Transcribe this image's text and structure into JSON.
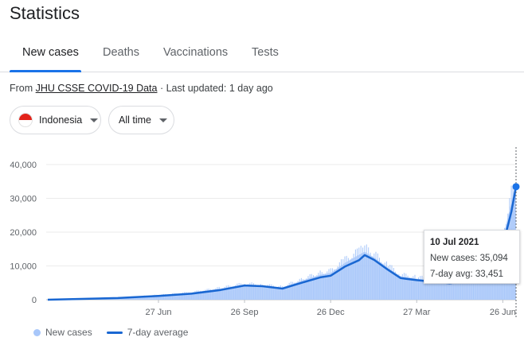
{
  "page": {
    "title": "Statistics"
  },
  "tabs": [
    {
      "label": "New cases"
    },
    {
      "label": "Deaths"
    },
    {
      "label": "Vaccinations"
    },
    {
      "label": "Tests"
    }
  ],
  "source": {
    "prefix": "From",
    "link": "JHU CSSE COVID-19 Data",
    "suffix": "· Last updated: 1 day ago"
  },
  "filters": {
    "region": "Indonesia",
    "period": "All time"
  },
  "colors": {
    "accent": "#1a73e8",
    "bars": "#a8c7fa",
    "avg_line": "#1967d2",
    "flag_red": "#e2231a"
  },
  "tooltip": {
    "date": "10 Jul 2021",
    "new_cases": "New cases: 35,094",
    "avg": "7-day avg: 33,451"
  },
  "legend": {
    "bars": "New cases",
    "line": "7-day average"
  },
  "chart_data": {
    "type": "area",
    "x_ticks": [
      "27 Jun",
      "26 Sep",
      "26 Dec",
      "27 Mar",
      "26 Jun"
    ],
    "y_ticks": [
      "0",
      "10,000",
      "20,000",
      "30,000",
      "40,000"
    ],
    "ylim": [
      0,
      42000
    ],
    "grid": true,
    "legend_position": "bottom-left",
    "series": [
      {
        "name": "7-day average",
        "x": [
          "2020-03-02",
          "2020-04-15",
          "2020-05-15",
          "2020-06-27",
          "2020-08-01",
          "2020-09-01",
          "2020-09-26",
          "2020-10-15",
          "2020-11-05",
          "2020-11-25",
          "2020-12-15",
          "2020-12-26",
          "2021-01-10",
          "2021-01-25",
          "2021-01-31",
          "2021-02-10",
          "2021-02-25",
          "2021-03-10",
          "2021-03-27",
          "2021-04-15",
          "2021-05-01",
          "2021-05-20",
          "2021-06-01",
          "2021-06-15",
          "2021-06-26",
          "2021-07-05",
          "2021-07-10"
        ],
        "values": [
          0,
          300,
          500,
          1100,
          1800,
          2900,
          4200,
          4000,
          3300,
          5000,
          6600,
          7100,
          9800,
          11700,
          13200,
          11800,
          8800,
          6400,
          5800,
          5300,
          4900,
          5600,
          5000,
          8500,
          16000,
          26000,
          33451
        ]
      },
      {
        "name": "New cases",
        "x": [
          "2020-03-02",
          "2020-04-15",
          "2020-05-15",
          "2020-06-27",
          "2020-08-01",
          "2020-09-01",
          "2020-09-26",
          "2020-10-15",
          "2020-11-05",
          "2020-11-25",
          "2020-12-15",
          "2020-12-26",
          "2021-01-10",
          "2021-01-25",
          "2021-01-31",
          "2021-02-10",
          "2021-02-25",
          "2021-03-10",
          "2021-03-27",
          "2021-04-15",
          "2021-05-01",
          "2021-05-20",
          "2021-06-01",
          "2021-06-15",
          "2021-06-26",
          "2021-07-05",
          "2021-07-10"
        ],
        "values": [
          0,
          400,
          600,
          1300,
          2100,
          3300,
          4500,
          4100,
          3600,
          5600,
          7400,
          7900,
          10900,
          13300,
          14200,
          12500,
          9400,
          6900,
          6200,
          5600,
          5300,
          6100,
          5400,
          9600,
          18000,
          29000,
          35094
        ]
      }
    ]
  }
}
